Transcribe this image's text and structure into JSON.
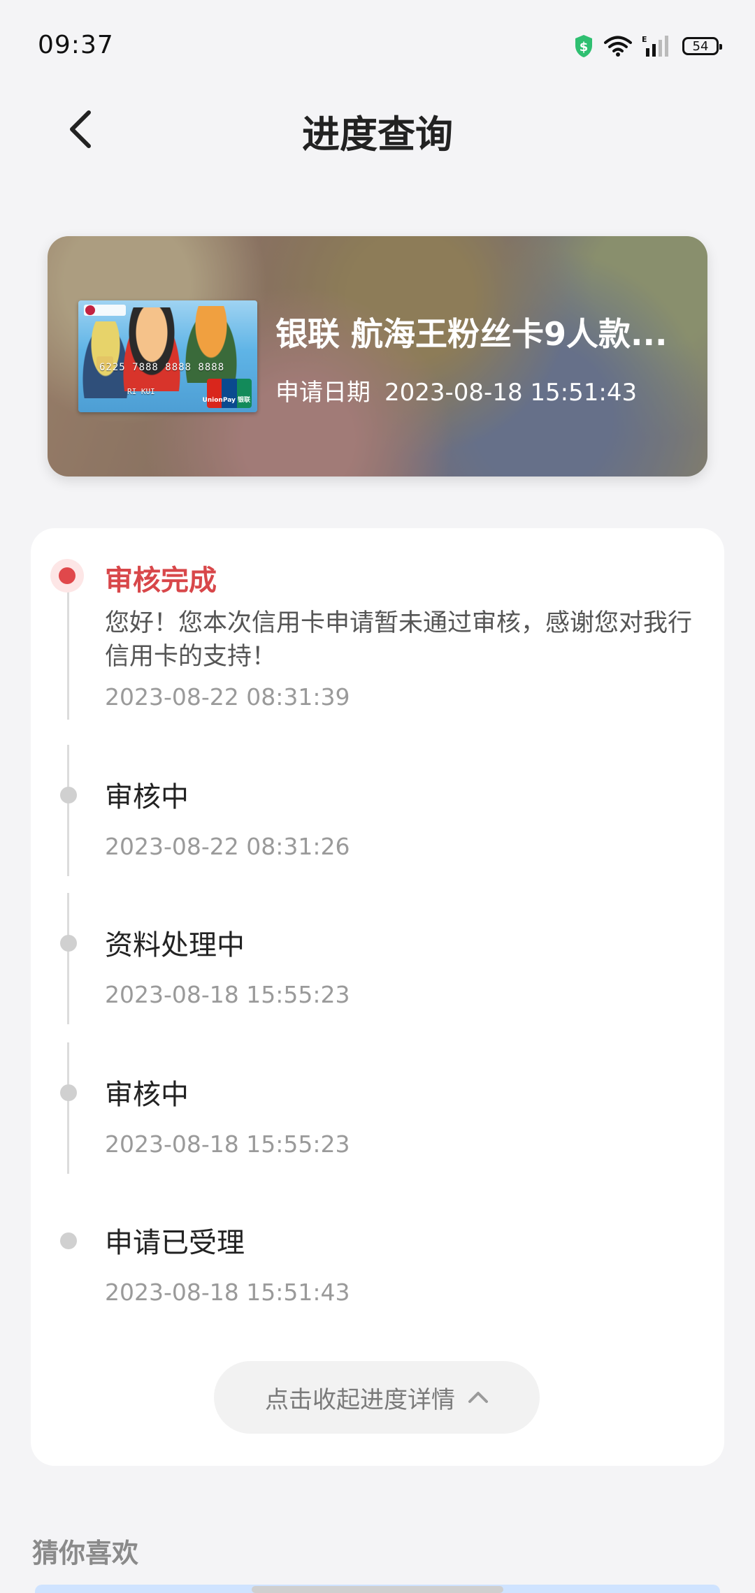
{
  "status_bar": {
    "time": "09:37",
    "battery": "54",
    "network_label": "E",
    "icons": [
      "shield-dollar-icon",
      "wifi-icon",
      "signal-icon",
      "battery-icon"
    ]
  },
  "navbar": {
    "title": "进度查询",
    "back_icon": "chevron-left-icon"
  },
  "card": {
    "name": "银联 航海王粉丝卡9人款...",
    "date_label": "申请日期",
    "date_value": "2023-08-18 15:51:43"
  },
  "progress": {
    "steps": [
      {
        "title": "审核完成",
        "desc": "您好！您本次信用卡申请暂未通过审核，感谢您对我行信用卡的支持！",
        "time": "2023-08-22 08:31:39",
        "active": true
      },
      {
        "title": "审核中",
        "time": "2023-08-22 08:31:26",
        "active": false
      },
      {
        "title": "资料处理中",
        "time": "2023-08-18 15:55:23",
        "active": false
      },
      {
        "title": "审核中",
        "time": "2023-08-18 15:55:23",
        "active": false
      },
      {
        "title": "申请已受理",
        "time": "2023-08-18 15:51:43",
        "active": false
      }
    ],
    "collapse_label": "点击收起进度详情"
  },
  "recommend": {
    "title": "猜你喜欢"
  },
  "colors": {
    "accent_red": "#e0484b",
    "page_bg": "#f4f4f6",
    "muted_text": "#9a9a9a"
  }
}
